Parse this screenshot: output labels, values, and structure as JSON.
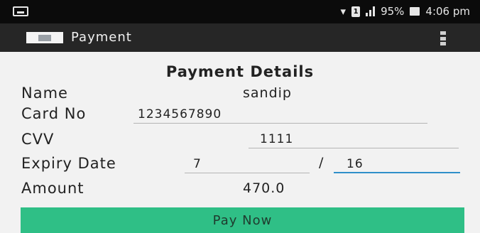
{
  "status_bar": {
    "battery": "95%",
    "time": "4:06 pm",
    "icons": [
      "notification-icon",
      "wifi-icon",
      "sim-icon",
      "signal-icon",
      "battery-icon"
    ]
  },
  "app_bar": {
    "title": "Payment",
    "menu_icon": "overflow-menu-icon"
  },
  "form": {
    "heading": "Payment Details",
    "name_label": "Name",
    "name_value": "sandip",
    "card_label": "Card No",
    "card_value": "1234567890",
    "cvv_label": "CVV",
    "cvv_value": "1111",
    "expiry_label": "Expiry Date",
    "expiry_month": "7",
    "expiry_separator": "/",
    "expiry_year": "16",
    "amount_label": "Amount",
    "amount_value": "470.0",
    "pay_button": "Pay Now"
  },
  "colors": {
    "status_bar": "#0b0b0b",
    "app_bar": "#262626",
    "background": "#f2f2f2",
    "button": "#2fbf86",
    "focus_underline": "#2f8fc9"
  }
}
